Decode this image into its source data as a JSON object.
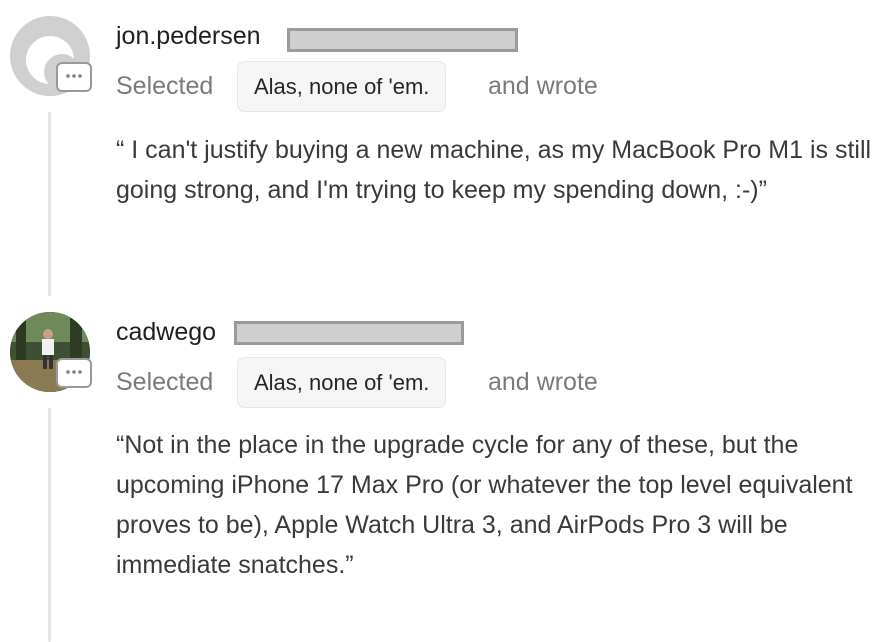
{
  "comments": [
    {
      "username": "jon.pedersen",
      "selected_label": "Selected",
      "choice": "Alas, none of 'em.",
      "wrote_label": "and wrote",
      "quote": "“ I can't justify buying a new machine, as my MacBook Pro M1 is still going strong, and I'm trying to keep my spending down, :-)”"
    },
    {
      "username": "cadwego",
      "selected_label": "Selected",
      "choice": "Alas, none of 'em.",
      "wrote_label": "and wrote",
      "quote": "“Not in the place in the upgrade cycle for any of these, but the upcoming iPhone 17 Max Pro (or whatever the top level equivalent proves to be), Apple Watch Ultra 3, and AirPods Pro 3 will be immediate snatches.”"
    }
  ]
}
